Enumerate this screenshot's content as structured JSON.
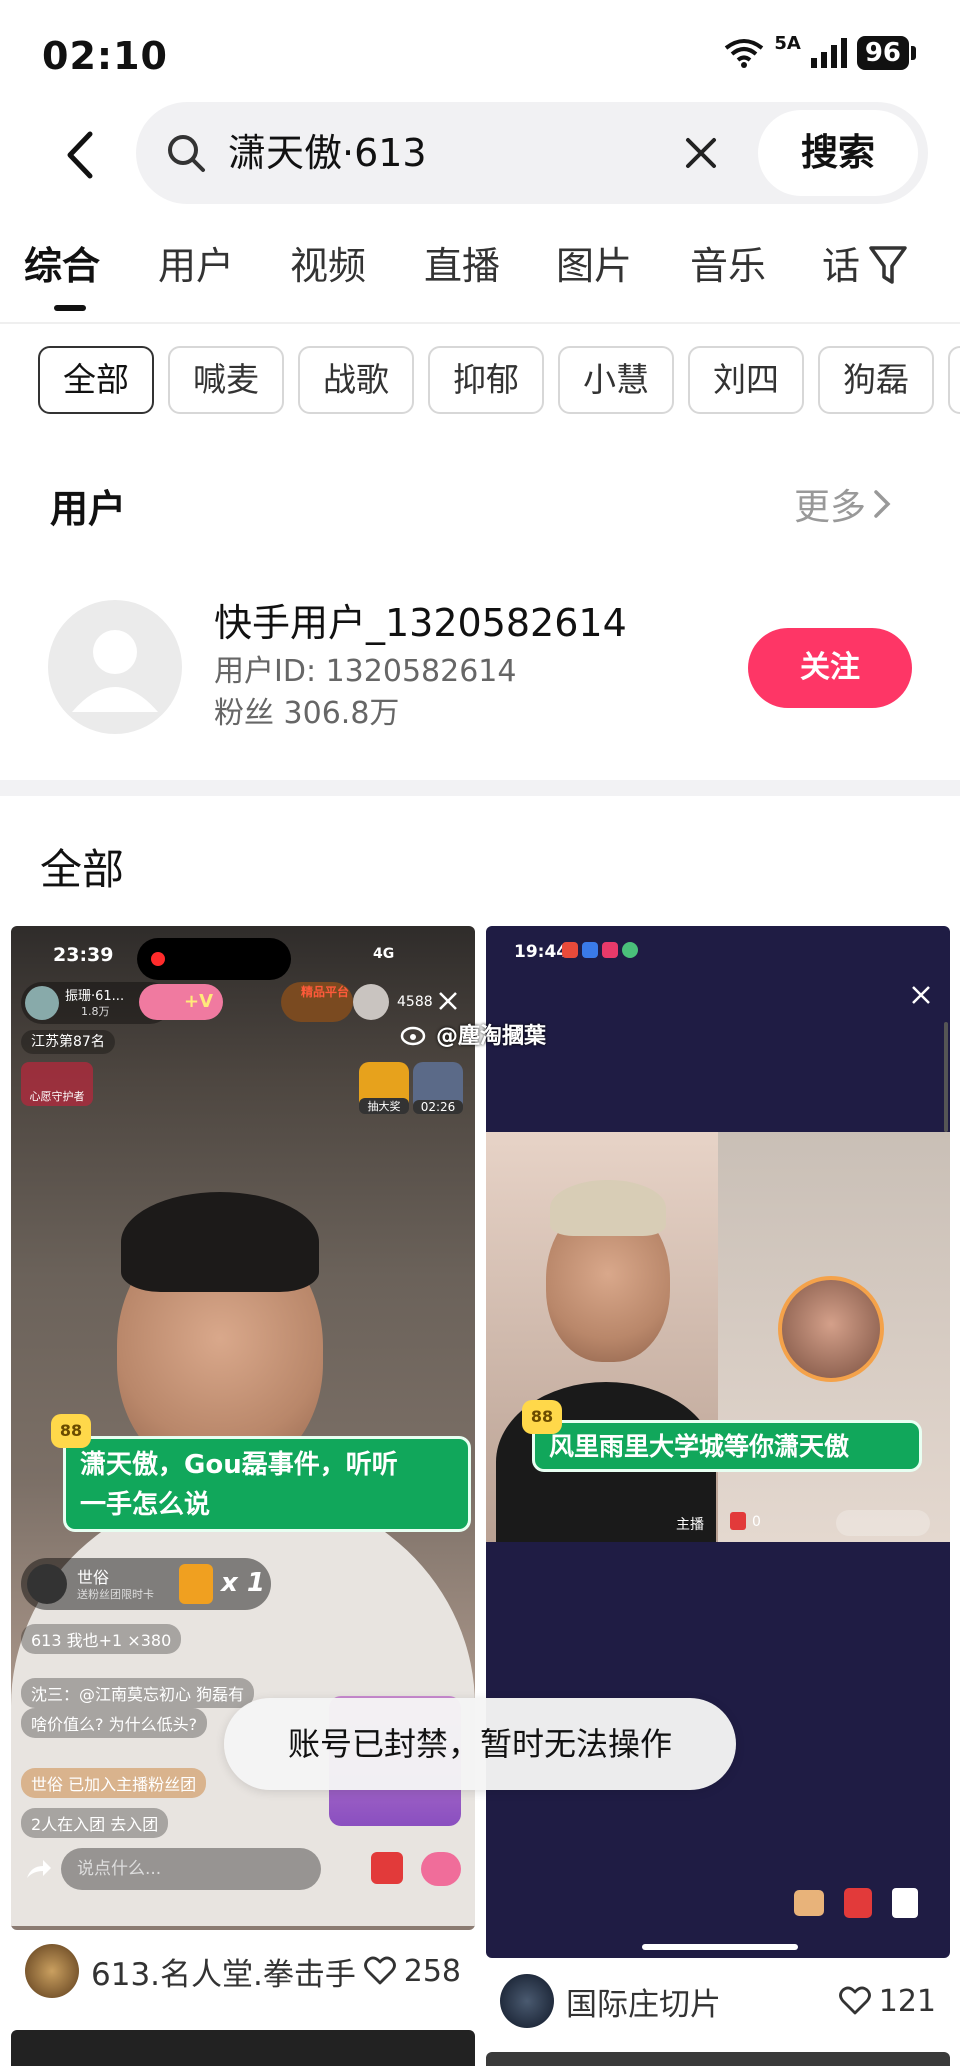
{
  "status_bar": {
    "time": "02:10",
    "network": "5A",
    "battery": "96"
  },
  "search": {
    "query": "潇天傲·613",
    "submit_label": "搜索"
  },
  "tabs": [
    "综合",
    "用户",
    "视频",
    "直播",
    "图片",
    "音乐",
    "话"
  ],
  "chips": [
    "全部",
    "喊麦",
    "战歌",
    "抑郁",
    "小慧",
    "刘四",
    "狗磊"
  ],
  "users_section": {
    "title": "用户",
    "more_label": "更多",
    "user": {
      "name": "快手用户_1320582614",
      "id_text": "用户ID: 1320582614",
      "fans_text": "粉丝 306.8万",
      "follow_label": "关注"
    }
  },
  "all_section": {
    "title": "全部"
  },
  "cards": [
    {
      "overlay_time": "23:39",
      "network": "4G",
      "host_name": "振珊·61...",
      "host_fans": "1.8万",
      "viewers": "4588",
      "rank": "江苏第87名",
      "guard": "心愿守护者",
      "lottery": "抽大奖",
      "countdown": "02:26",
      "badge": "精品平台",
      "bubble_line1": "潇天傲，Gou磊事件，听听",
      "bubble_line2": "一手怎么说",
      "gift_user": "世俗",
      "gift_sub": "送粉丝团限时卡",
      "gift_count": "x 1",
      "chat": [
        "613  我也+1  ×380",
        "沈三：@江南莫忘初心 狗磊有",
        "啥价值么? 为什么低头?",
        "世俗 已加入主播粉丝团",
        "2人在入团  去入团"
      ],
      "chat_placeholder": "说点什么...",
      "title": "613.名人堂.拳击手",
      "likes": "258"
    },
    {
      "overlay_time": "19:44",
      "bubble_text": "风里雨里大学城等你潇天傲",
      "host_label": "主播",
      "host_count": "0",
      "title": "国际庄切片",
      "likes": "121"
    }
  ],
  "watermark": "@塵淘摑葉",
  "toast": "账号已封禁，暂时无法操作",
  "colors": {
    "follow": "#fe3666",
    "bubble": "#11a75b"
  }
}
